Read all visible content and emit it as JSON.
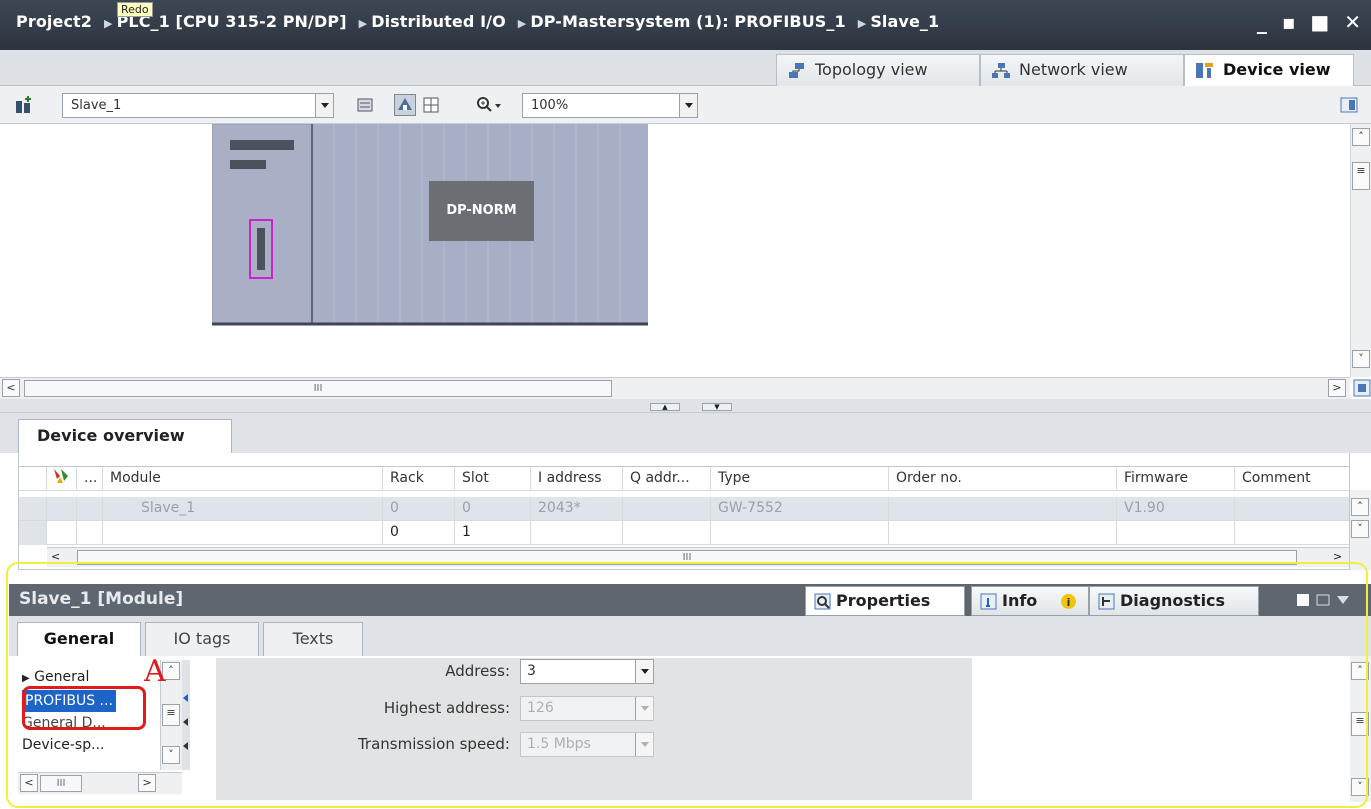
{
  "title_bar": {
    "breadcrumbs": [
      "Project2",
      "PLC_1 [CPU 315-2 PN/DP]",
      "Distributed I/O",
      "DP-Mastersystem (1): PROFIBUS_1",
      "Slave_1"
    ],
    "tooltip": "Redo",
    "window_controls": "_ ▪ ■ ✕"
  },
  "view_tabs": [
    {
      "label": "Topology view",
      "icon": "topology-icon"
    },
    {
      "label": "Network view",
      "icon": "network-icon"
    },
    {
      "label": "Device view",
      "icon": "device-icon"
    }
  ],
  "toolbar": {
    "device_select": "Slave_1",
    "zoom": "100%"
  },
  "canvas": {
    "module_label": "DP-NORM",
    "hscroll_mark": "III"
  },
  "device_overview": {
    "tab_label": "Device overview",
    "columns": [
      "...",
      "Module",
      "Rack",
      "Slot",
      "I address",
      "Q addr...",
      "Type",
      "Order no.",
      "Firmware",
      "Comment"
    ],
    "rows": [
      {
        "module": "Slave_1",
        "rack": "0",
        "slot": "0",
        "i_address": "2043*",
        "q_address": "",
        "type": "GW-7552",
        "order_no": "",
        "firmware": "V1.90",
        "comment": ""
      },
      {
        "module": "",
        "rack": "0",
        "slot": "1",
        "i_address": "",
        "q_address": "",
        "type": "",
        "order_no": "",
        "firmware": "",
        "comment": ""
      }
    ],
    "hscroll_mark": "III"
  },
  "inspector": {
    "title": "Slave_1 [Module]",
    "tabs": [
      "Properties",
      "Info",
      "Diagnostics"
    ],
    "property_tabs": [
      "General",
      "IO tags",
      "Texts"
    ],
    "nav_items": [
      "General",
      "PROFIBUS ...",
      "General D...",
      "Device-sp..."
    ],
    "nav_hscroll_mark": "III",
    "fields": {
      "address_label": "Address:",
      "address_value": "3",
      "highest_label": "Highest address:",
      "highest_value": "126",
      "speed_label": "Transmission speed:",
      "speed_value": "1.5 Mbps"
    },
    "annotation_letter": "A"
  },
  "colors": {
    "title_bg": "#2c343f",
    "selection": "#1d64c8",
    "highlight_yellow": "#f2ef3a",
    "annotation_red": "#e21a1a",
    "module_gray": "#6b6f74",
    "rack_blue": "#a9b0c6"
  }
}
